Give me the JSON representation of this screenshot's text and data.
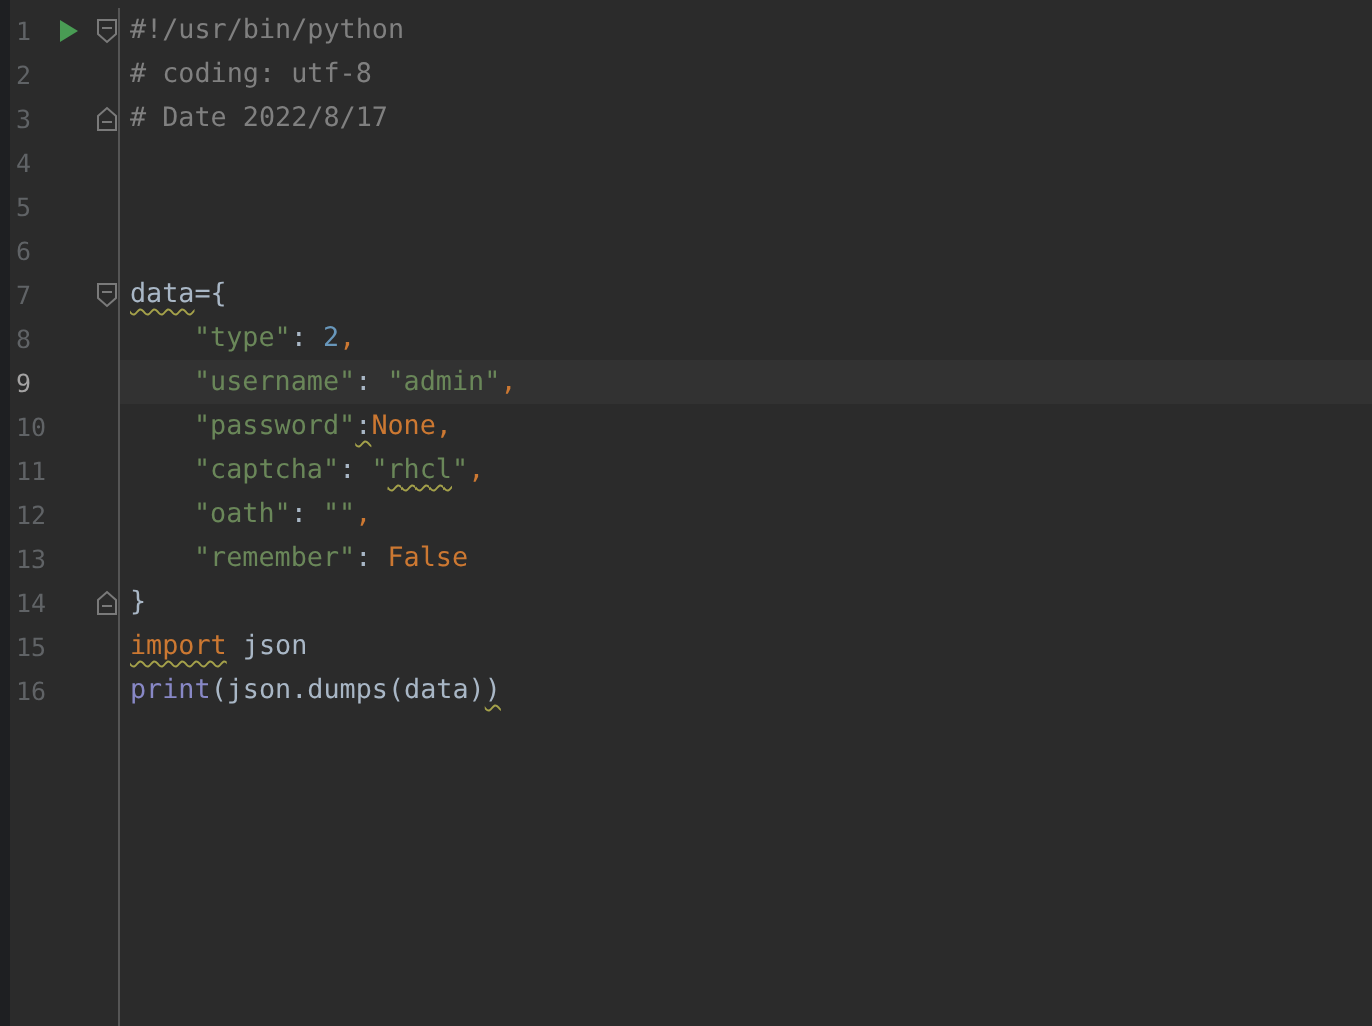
{
  "editor": {
    "lines": [
      {
        "number": "1",
        "current": false,
        "run": true,
        "fold_start": true,
        "tokens": [
          {
            "kind": "comment",
            "text": "#!/usr/bin/python"
          }
        ]
      },
      {
        "number": "2",
        "current": false,
        "tokens": [
          {
            "kind": "comment",
            "text": "# coding: utf-8"
          }
        ]
      },
      {
        "number": "3",
        "current": false,
        "fold_end": true,
        "tokens": [
          {
            "kind": "comment",
            "text": "# Date 2022/8/17"
          }
        ]
      },
      {
        "number": "4",
        "current": false
      },
      {
        "number": "5",
        "current": false
      },
      {
        "number": "6",
        "current": false
      },
      {
        "number": "7",
        "current": false,
        "fold_start": true,
        "tokens": [
          {
            "kind": "plain",
            "text": "data",
            "squiggle": true
          },
          {
            "kind": "plain",
            "text": "={"
          }
        ]
      },
      {
        "number": "8",
        "current": false,
        "indent": true,
        "tokens": [
          {
            "kind": "string",
            "text": "\"type\""
          },
          {
            "kind": "plain",
            "text": ": "
          },
          {
            "kind": "number",
            "text": "2"
          },
          {
            "kind": "keyword",
            "text": ","
          }
        ]
      },
      {
        "number": "9",
        "current": true,
        "indent": true,
        "tokens": [
          {
            "kind": "string",
            "text": "\"username\""
          },
          {
            "kind": "plain",
            "text": ": "
          },
          {
            "kind": "string",
            "text": "\"admin\""
          },
          {
            "kind": "keyword",
            "text": ","
          }
        ]
      },
      {
        "number": "10",
        "current": false,
        "indent": true,
        "tokens": [
          {
            "kind": "string",
            "text": "\"password\""
          },
          {
            "kind": "plain",
            "text": ":",
            "squiggle": true
          },
          {
            "kind": "keyword",
            "text": "None,"
          }
        ]
      },
      {
        "number": "11",
        "current": false,
        "indent": true,
        "tokens": [
          {
            "kind": "string",
            "text": "\"captcha\""
          },
          {
            "kind": "plain",
            "text": ": "
          },
          {
            "kind": "string",
            "text": "\""
          },
          {
            "kind": "string",
            "text": "rhcl",
            "squiggle": true
          },
          {
            "kind": "string",
            "text": "\""
          },
          {
            "kind": "keyword",
            "text": ","
          }
        ]
      },
      {
        "number": "12",
        "current": false,
        "indent": true,
        "tokens": [
          {
            "kind": "string",
            "text": "\"oath\""
          },
          {
            "kind": "plain",
            "text": ": "
          },
          {
            "kind": "string",
            "text": "\"\""
          },
          {
            "kind": "keyword",
            "text": ","
          }
        ]
      },
      {
        "number": "13",
        "current": false,
        "indent": true,
        "tokens": [
          {
            "kind": "string",
            "text": "\"remember\""
          },
          {
            "kind": "plain",
            "text": ": "
          },
          {
            "kind": "keyword",
            "text": "False"
          }
        ]
      },
      {
        "number": "14",
        "current": false,
        "fold_end": true,
        "tokens": [
          {
            "kind": "plain",
            "text": "}"
          }
        ]
      },
      {
        "number": "15",
        "current": false,
        "tokens": [
          {
            "kind": "keyword",
            "text": "import",
            "squiggle": true
          },
          {
            "kind": "plain",
            "text": " json"
          }
        ]
      },
      {
        "number": "16",
        "current": false,
        "tokens": [
          {
            "kind": "builtin",
            "text": "print"
          },
          {
            "kind": "plain",
            "text": "(json.dumps(data)"
          },
          {
            "kind": "plain",
            "text": ")",
            "squiggle": true
          }
        ]
      }
    ]
  }
}
